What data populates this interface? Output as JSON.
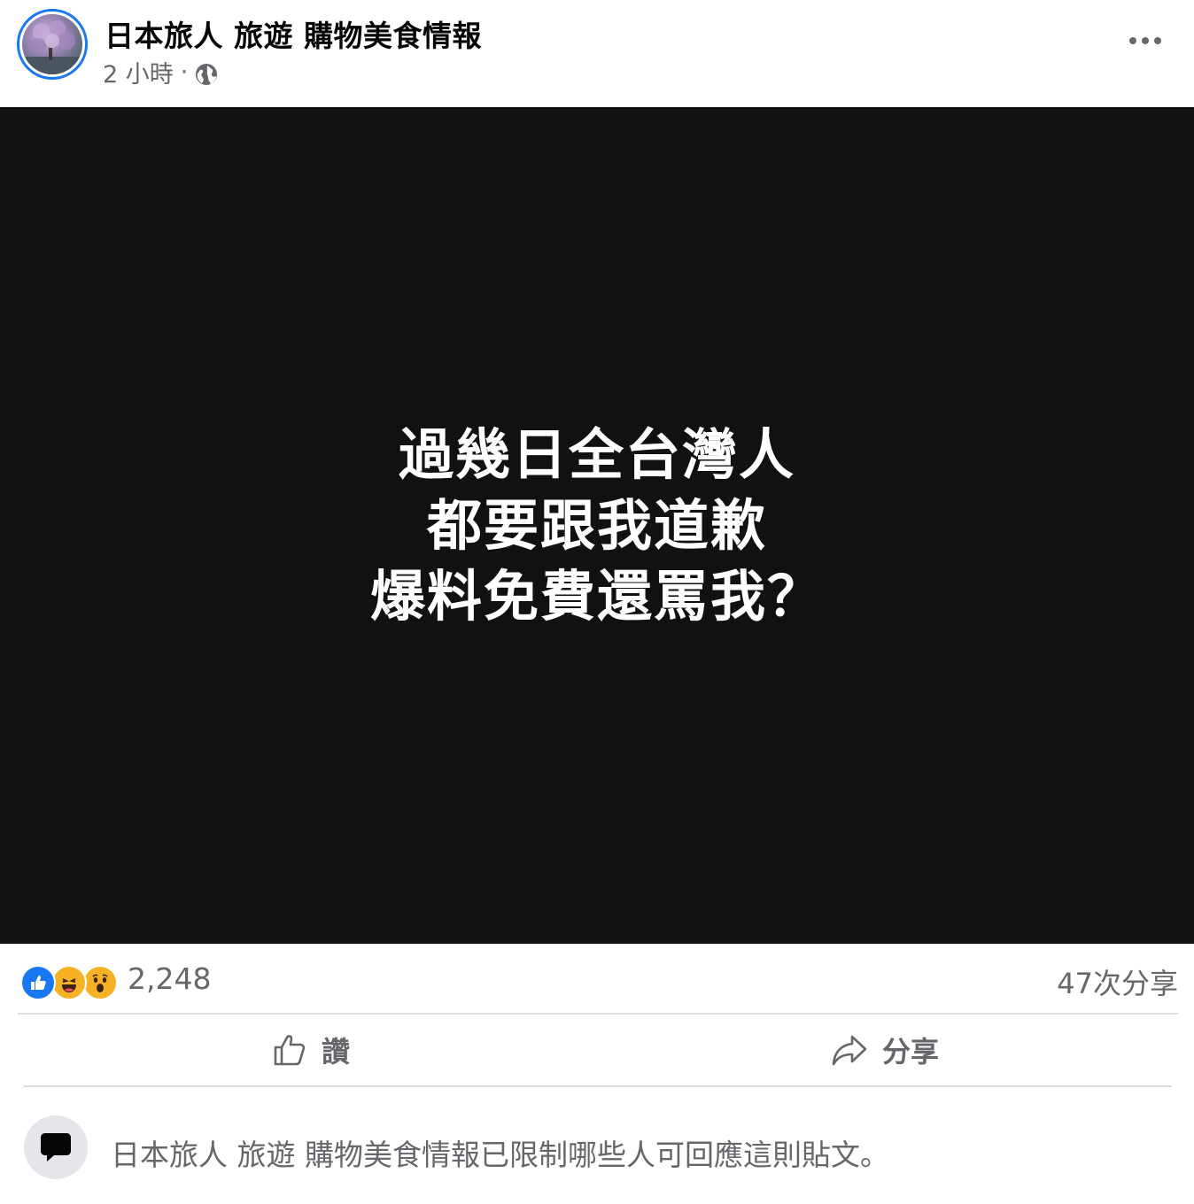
{
  "post": {
    "page_name": "日本旅人 旅遊 購物美食情報",
    "time": "2 小時",
    "separator": "·",
    "audience_icon": "globe-icon",
    "more_icon": "more-horizontal-icon"
  },
  "media": {
    "lines": [
      "過幾日全台灣人",
      "都要跟我道歉",
      "爆料免費還罵我？"
    ]
  },
  "summary": {
    "reactions": [
      "like-reaction-icon",
      "haha-reaction-icon",
      "wow-reaction-icon"
    ],
    "reaction_count": "2,248",
    "share_count": "47次分享"
  },
  "actions": {
    "like_label": "讚",
    "share_label": "分享"
  },
  "notice": {
    "text": "日本旅人 旅遊 購物美食情報已限制哪些人可回應這則貼文。"
  },
  "colors": {
    "brand": "#1877f2",
    "secondary_text": "#65676b",
    "media_background": "#111112",
    "divider": "#dadde1"
  }
}
